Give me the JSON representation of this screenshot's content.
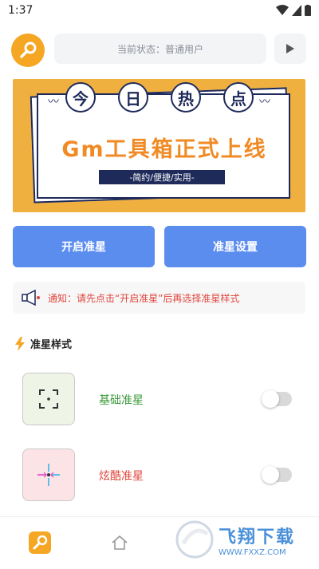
{
  "statusbar": {
    "time": "1:37"
  },
  "header": {
    "status_text": "当前状态：普通用户"
  },
  "banner": {
    "chars": [
      "今",
      "日",
      "热",
      "点"
    ],
    "headline": "Gm工具箱正式上线",
    "tagline": "-简约/便捷/实用-"
  },
  "actions": {
    "start_label": "开启准星",
    "settings_label": "准星设置"
  },
  "notice": {
    "text": "通知：请先点击“开启准星”后再选择准星样式"
  },
  "section": {
    "title": "准星样式"
  },
  "styles": [
    {
      "label": "基础准星",
      "label_color": "#3a9a3a",
      "thumb_bg": "#eef4e6",
      "enabled": false
    },
    {
      "label": "炫酷准星",
      "label_color": "#e0463b",
      "thumb_bg": "#fbe3e6",
      "enabled": false
    }
  ],
  "watermark": {
    "title": "飞翔下载",
    "url": "WWW.FXXZ.COM"
  },
  "colors": {
    "accent": "#f5a623",
    "primary": "#5b8def",
    "banner_bg": "#f0b040",
    "navy": "#1e2a5a"
  }
}
